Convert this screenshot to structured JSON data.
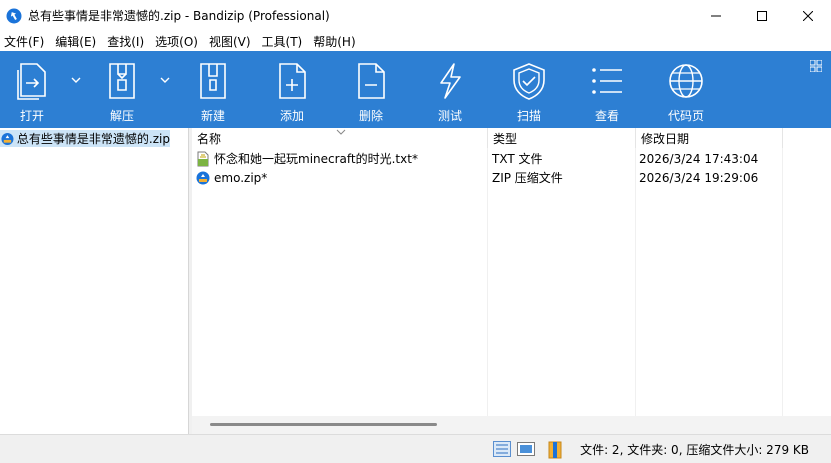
{
  "window": {
    "title": "总有些事情是非常遗憾的.zip - Bandizip (Professional)"
  },
  "menu": [
    {
      "label": "文件(F)"
    },
    {
      "label": "编辑(E)"
    },
    {
      "label": "查找(I)"
    },
    {
      "label": "选项(O)"
    },
    {
      "label": "视图(V)"
    },
    {
      "label": "工具(T)"
    },
    {
      "label": "帮助(H)"
    }
  ],
  "toolbar": {
    "open": "打开",
    "extract": "解压",
    "new": "新建",
    "add": "添加",
    "delete": "删除",
    "test": "测试",
    "scan": "扫描",
    "view": "查看",
    "codepage": "代码页"
  },
  "tree": {
    "archive": "总有些事情是非常遗憾的.zip"
  },
  "columns": {
    "name": "名称",
    "type": "类型",
    "date": "修改日期"
  },
  "files": [
    {
      "name": "怀念和她一起玩minecraft的时光.txt*",
      "type": "TXT 文件",
      "date": "2026/3/24 17:43:04",
      "icon": "text-file-icon"
    },
    {
      "name": "emo.zip*",
      "type": "ZIP 压缩文件",
      "date": "2026/3/24 19:29:06",
      "icon": "zip-file-icon"
    }
  ],
  "status": {
    "summary": "文件: 2, 文件夹: 0, 压缩文件大小: 279 KB"
  },
  "colors": {
    "toolbar": "#2d7fd3",
    "selection": "#cce4f7"
  }
}
